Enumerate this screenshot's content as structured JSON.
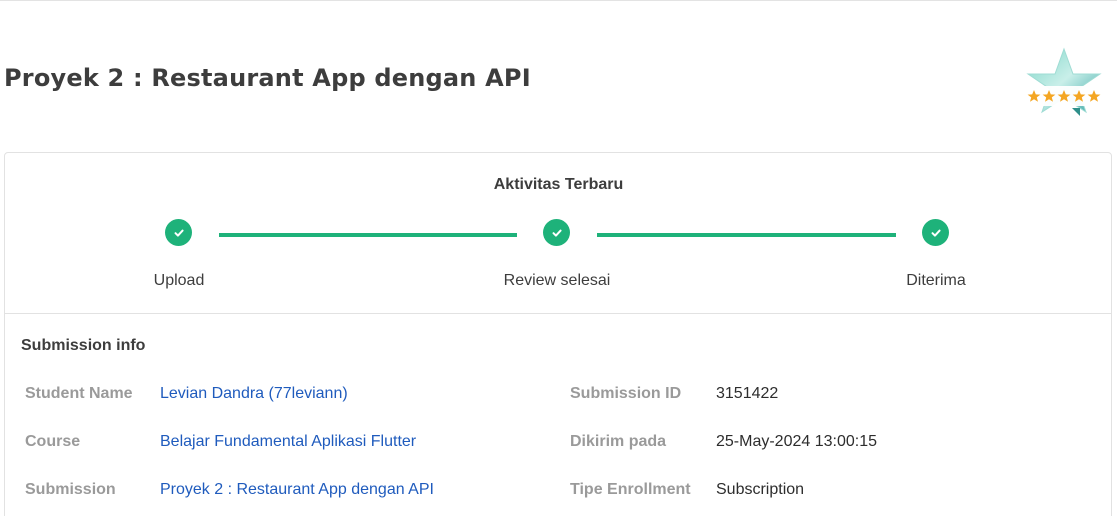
{
  "page": {
    "title": "Proyek 2 : Restaurant App dengan API"
  },
  "badge": {
    "icon": "star-rating-badge-icon",
    "rating": 5,
    "max_rating": 5,
    "star_color": "#f4a623"
  },
  "activity": {
    "title": "Aktivitas Terbaru",
    "steps": [
      {
        "label": "Upload",
        "status": "done"
      },
      {
        "label": "Review selesai",
        "status": "done"
      },
      {
        "label": "Diterima",
        "status": "done"
      }
    ],
    "accent_color": "#1eb27a"
  },
  "submission_info": {
    "title": "Submission info",
    "left": [
      {
        "label": "Student Name",
        "value": "Levian Dandra (77leviann)"
      },
      {
        "label": "Course",
        "value": "Belajar Fundamental Aplikasi Flutter"
      },
      {
        "label": "Submission",
        "value": "Proyek 2 : Restaurant App dengan API"
      }
    ],
    "right": [
      {
        "label": "Submission ID",
        "value": "3151422"
      },
      {
        "label": "Dikirim pada",
        "value": "25-May-2024 13:00:15"
      },
      {
        "label": "Tipe Enrollment",
        "value": "Subscription"
      }
    ],
    "link_color": "#1f5bbd"
  }
}
